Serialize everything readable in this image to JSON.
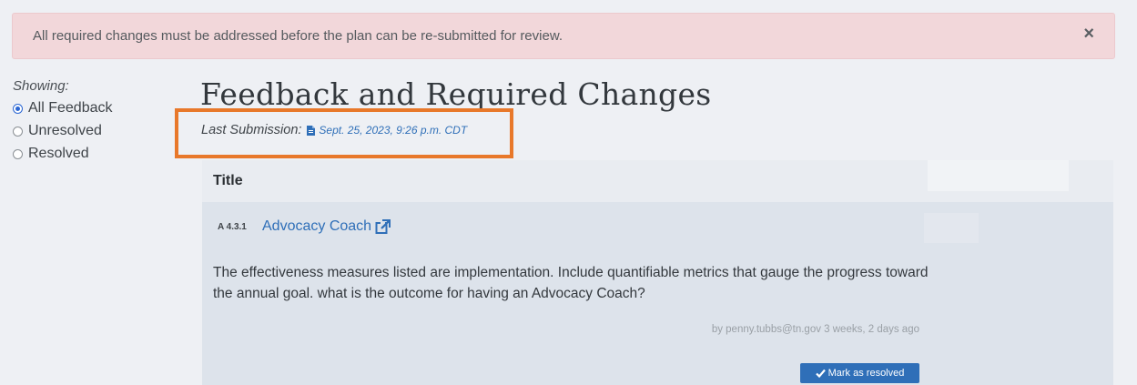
{
  "alert": {
    "message": "All required changes must be addressed before the plan can be re-submitted for review.",
    "close_label": "×"
  },
  "filter": {
    "label": "Showing:",
    "options": [
      {
        "label": "All Feedback",
        "selected": true
      },
      {
        "label": "Unresolved",
        "selected": false
      },
      {
        "label": "Resolved",
        "selected": false
      }
    ]
  },
  "main": {
    "title": "Feedback and Required Changes",
    "submission_label": "Last Submission:",
    "submission_date": "Sept. 25, 2023, 9:26 p.m. CDT",
    "table_header": "Title"
  },
  "feedback_item": {
    "code": "A 4.3.1",
    "title": "Advocacy Coach",
    "comment": "The effectiveness measures listed are implementation. Include quantifiable metrics that gauge the progress toward the annual goal. what is the outcome for having an Advocacy Coach?",
    "meta": "by penny.tubbs@tn.gov 3 weeks, 2 days ago",
    "resolve_label": "Mark as resolved"
  },
  "colors": {
    "accent": "#2f6fb8",
    "highlight": "#e8782a",
    "alert_bg": "#f2d7da"
  }
}
